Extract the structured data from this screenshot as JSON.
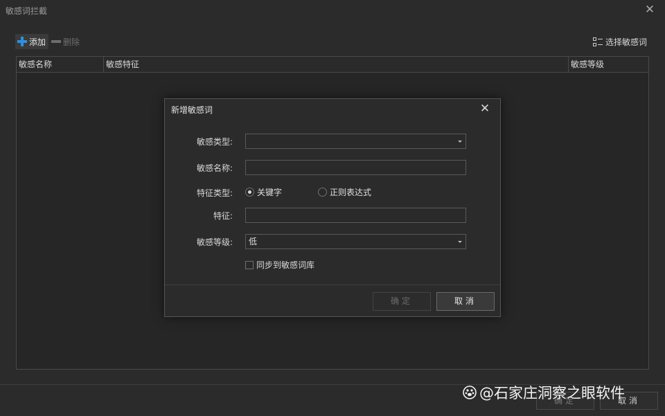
{
  "window": {
    "title": "敏感词拦截",
    "close_glyph": "✕"
  },
  "toolbar": {
    "add_label": "添加",
    "delete_label": "删除",
    "select_words_label": "选择敏感词"
  },
  "table": {
    "columns": [
      "敏感名称",
      "敏感特征",
      "敏感等级"
    ],
    "rows": []
  },
  "footer": {
    "ok_label": "确定",
    "cancel_label": "取消"
  },
  "modal": {
    "title": "新增敏感词",
    "close_glyph": "✕",
    "type_label": "敏感类型:",
    "type_value": "",
    "name_label": "敏感名称:",
    "name_value": "",
    "feature_type_label": "特征类型:",
    "feature_type_options": [
      "关键字",
      "正则表达式"
    ],
    "feature_type_selected": "关键字",
    "feature_label": "特征:",
    "feature_value": "",
    "level_label": "敏感等级:",
    "level_value": "低",
    "sync_label": "同步到敏感词库",
    "sync_checked": false,
    "confirm_label": "确定",
    "cancel_label": "取消"
  },
  "watermark": {
    "text": "@石家庄洞察之眼软件"
  },
  "colors": {
    "accent": "#2f8fe0",
    "background": "#2b2b2b"
  }
}
